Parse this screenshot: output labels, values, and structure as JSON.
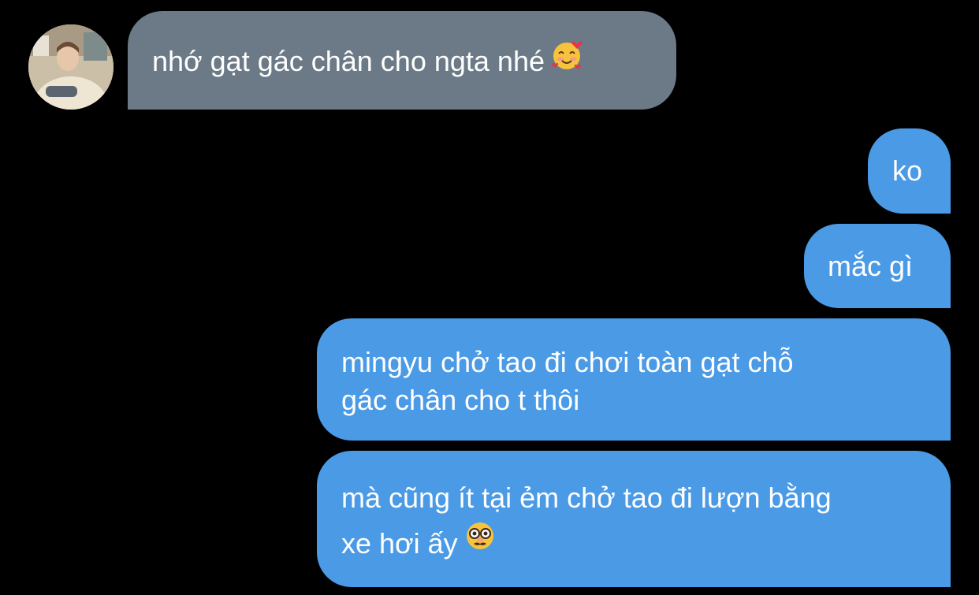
{
  "messages": {
    "incoming_1": {
      "text": "nhớ gạt gác chân cho ngta nhé",
      "emoji_icon": "smiling-face-with-hearts-icon"
    },
    "outgoing_1": {
      "text": "ko"
    },
    "outgoing_2": {
      "text": "mắc gì"
    },
    "outgoing_3": {
      "line1": "mingyu chở tao đi chơi toàn gạt chỗ",
      "line2": "gác chân cho t thôi"
    },
    "outgoing_4": {
      "line1": "mà cũng ít tại ẻm chở tao đi lượn bằng",
      "line2": "xe hơi ấy",
      "emoji_icon": "disguised-face-icon"
    }
  },
  "colors": {
    "background": "#000000",
    "incoming_bubble": "#6b7a86",
    "outgoing_bubble": "#4a9ae6",
    "text": "#ffffff"
  }
}
